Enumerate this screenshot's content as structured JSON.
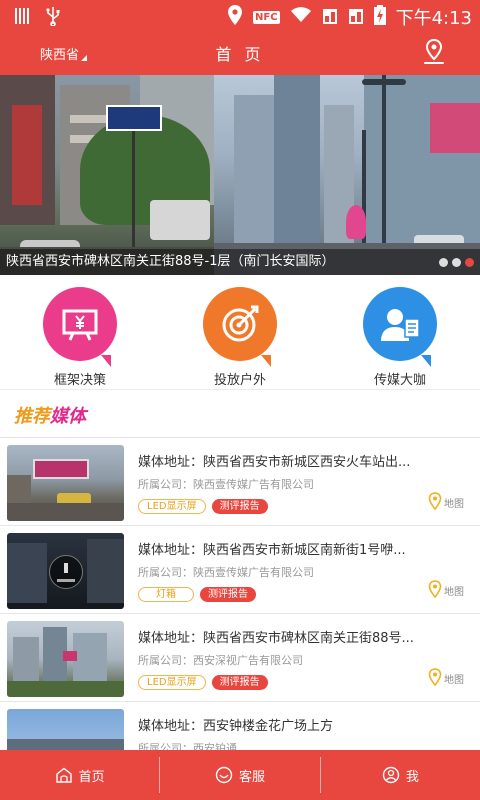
{
  "status_bar": {
    "time": "下午4:13",
    "nfc": "NFC",
    "icons": [
      "barcode-icon",
      "usb-icon",
      "location-icon",
      "nfc-icon",
      "wifi-icon",
      "signal-icon",
      "signal-icon-2",
      "battery-icon"
    ]
  },
  "navbar": {
    "region": "陕西省",
    "title": "首 页",
    "icon": "map-location-icon"
  },
  "banner": {
    "caption": "陕西省西安市碑林区南关正街88号-1层（南门长安国际）",
    "slides": 3,
    "active_slide": 3
  },
  "categories": [
    {
      "label": "框架决策",
      "color": "#ea3c8b",
      "icon": "yuan-board-icon"
    },
    {
      "label": "投放户外",
      "color": "#f0782a",
      "icon": "target-icon"
    },
    {
      "label": "传媒大咖",
      "color": "#2e90e4",
      "icon": "person-icon"
    }
  ],
  "section": {
    "title_part1": "推荐",
    "title_part2": "媒体"
  },
  "list": {
    "map_label": "地图",
    "items": [
      {
        "address": "媒体地址：陕西省西安市新城区西安火车站出...",
        "company": "所属公司：陕西壹传媒广告有限公司",
        "type": "LED显示屏",
        "report": "测评报告"
      },
      {
        "address": "媒体地址：陕西省西安市新城区南新街1号咿...",
        "company": "所属公司：陕西壹传媒广告有限公司",
        "type": "灯箱",
        "report": "测评报告"
      },
      {
        "address": "媒体地址：陕西省西安市碑林区南关正街88号...",
        "company": "所属公司：西安深视广告有限公司",
        "type": "LED显示屏",
        "report": "测评报告"
      },
      {
        "address": "媒体地址：西安钟楼金花广场上方",
        "company": "所属公司：西安铂通",
        "type": "",
        "report": ""
      }
    ]
  },
  "tabbar": {
    "tabs": [
      {
        "label": "首页",
        "icon": "home-icon"
      },
      {
        "label": "客服",
        "icon": "customer-service-icon"
      },
      {
        "label": "我",
        "icon": "user-icon"
      }
    ]
  },
  "colors": {
    "primary_red": "#e8473f",
    "accent_orange": "#f09a1a",
    "accent_pink": "#e0298a"
  }
}
